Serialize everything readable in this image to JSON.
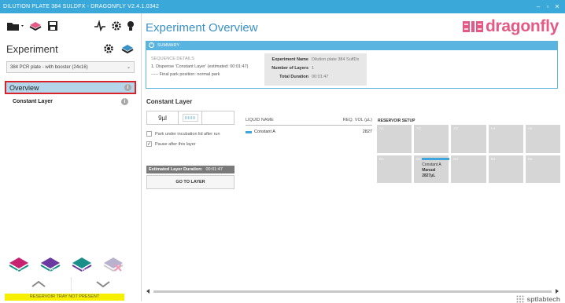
{
  "window": {
    "title": "DILUTION PLATE 384 SULDFX - DRAGONFLY V2.4.1.0342",
    "minimize": "–",
    "maximize": "▫",
    "close": "✕"
  },
  "sidebar": {
    "section_label": "Experiment",
    "plate_select": "384 PCR plate - with booster (24x16)",
    "nav_items": [
      {
        "label": "Overview",
        "selected": true
      },
      {
        "label": "Constant Layer",
        "selected": false
      }
    ],
    "add_buttons": [
      {
        "label": "Const",
        "color": "#c7226f"
      },
      {
        "label": "CSV",
        "color": "#6b3aa0"
      },
      {
        "label": "GFX",
        "color": "#1a8f8a"
      },
      {
        "label": "",
        "color": "#b9b2cf"
      }
    ],
    "status": "RESERVOIR TRAY NOT PRESENT"
  },
  "main": {
    "page_title": "Experiment Overview",
    "brand": "dragonfly",
    "brand_color": "#e55a84",
    "summary": {
      "header": "SUMMARY",
      "sequence_heading": "SEQUENCE DETAILS",
      "sequence_line": "1. Dispense 'Constant Layer' (estimated: 00:01:47)",
      "final_park": "----- Final park position: normal park",
      "experiment_name_label": "Experiment Name",
      "experiment_name": "Dilution plate 384 SulfDx",
      "number_of_layers_label": "Number of Layers",
      "number_of_layers": "1",
      "total_duration_label": "Total Duration",
      "total_duration": "00:01:47"
    },
    "layer": {
      "title": "Constant Layer",
      "volume": "9µl",
      "park_option": "Park under incubation lid after run",
      "park_checked": false,
      "pause_option": "Pause after this layer",
      "pause_checked": true,
      "estimated_label": "Estimated Layer Duration:",
      "estimated_value": "00:01:47",
      "goto_button": "GO TO LAYER"
    },
    "liquids": {
      "col_name": "LIQUID NAME",
      "col_vol": "REQ. VOL (µL)",
      "rows": [
        {
          "name": "Constant A",
          "vol": "2827",
          "color": "#3ea6dc"
        }
      ]
    },
    "reservoir": {
      "title": "RESERVOIR SETUP",
      "cells": [
        {
          "id": "A1",
          "liquid": "",
          "type": "",
          "vol": ""
        },
        {
          "id": "A2",
          "liquid": "",
          "type": "",
          "vol": ""
        },
        {
          "id": "A3",
          "liquid": "",
          "type": "",
          "vol": ""
        },
        {
          "id": "A4",
          "liquid": "",
          "type": "",
          "vol": ""
        },
        {
          "id": "A5",
          "liquid": "",
          "type": "",
          "vol": ""
        },
        {
          "id": "B1",
          "liquid": "",
          "type": "",
          "vol": ""
        },
        {
          "id": "B2",
          "liquid": "Constant A",
          "type": "Manual",
          "vol": "2827µL"
        },
        {
          "id": "B3",
          "liquid": "",
          "type": "",
          "vol": ""
        },
        {
          "id": "B4",
          "liquid": "",
          "type": "",
          "vol": ""
        },
        {
          "id": "B5",
          "liquid": "",
          "type": "",
          "vol": ""
        }
      ]
    },
    "footer_brand": "sptlabtech"
  }
}
